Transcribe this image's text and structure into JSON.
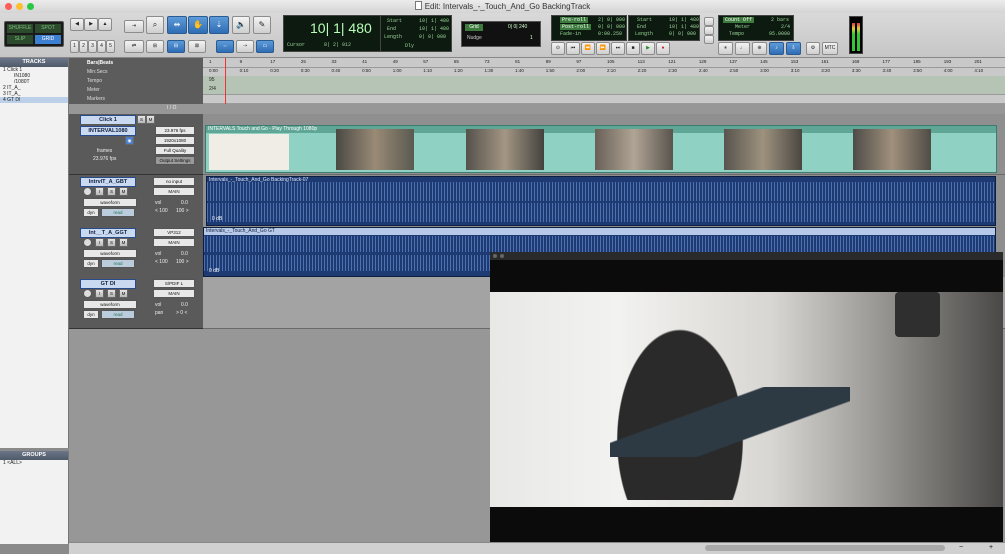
{
  "window": {
    "title": "Edit: Intervals_-_Touch_And_Go BackingTrack"
  },
  "toolbar": {
    "modes": [
      "SHUFFLE",
      "SPOT",
      "SLIP",
      "GRID"
    ],
    "zoom_presets": [
      "1",
      "2",
      "3",
      "4",
      "5"
    ],
    "main_counter": "10| 1| 480",
    "cursor_label": "Cursor",
    "cursor_value": "8| 2| 012",
    "dly_label": "Dly",
    "start_label": "Start",
    "start_value": "10| 1| 480",
    "end_label": "End",
    "end_value": "10| 1| 480",
    "length_label": "Length",
    "length_value": "0| 0| 000",
    "grid_label": "Grid",
    "grid_value": "0| 0| 240",
    "nudge_label": "Nudge",
    "nudge_value": "1",
    "preroll_label": "Pre-roll",
    "preroll_value": "2| 0| 000",
    "postroll_label": "Post-roll",
    "postroll_value": "0| 0| 000",
    "fadein_label": "Fade-in",
    "fadein_value": "0:00.250",
    "t_start_label": "Start",
    "t_start_value": "10| 1| 480",
    "t_end_label": "End",
    "t_end_value": "10| 1| 480",
    "t_length_label": "Length",
    "t_length_value": "0| 0| 000",
    "countoff_label": "Count Off",
    "countoff_value": "2 bars",
    "meter_label": "Meter",
    "meter_value": "2/4",
    "tempo_label": "Tempo",
    "tempo_value": "95.0000",
    "mtc_label": "MTC"
  },
  "tracks_panel": {
    "title": "TRACKS",
    "items": [
      {
        "label": "1  Click 1"
      },
      {
        "label": "IN1080"
      },
      {
        "label": "/1080T"
      },
      {
        "label": "2  IT_A_"
      },
      {
        "label": "3  IT_A_"
      },
      {
        "label": "4  GT DI"
      }
    ]
  },
  "groups_panel": {
    "title": "GROUPS",
    "items": [
      {
        "label": "1  <ALL>"
      }
    ]
  },
  "rulers": {
    "bars_label": "Bars|Beats",
    "mins_label": "Min:Secs",
    "tempo_label": "Tempo",
    "meter_label": "Meter",
    "markers_label": "Markers",
    "tempo_value": "95",
    "meter_value": "2/4",
    "bars": [
      "1",
      "9",
      "17",
      "25",
      "33",
      "41",
      "49",
      "57",
      "65",
      "73",
      "81",
      "89",
      "97",
      "105",
      "113",
      "121",
      "129",
      "137",
      "145",
      "153",
      "161",
      "169",
      "177",
      "185",
      "193",
      "201"
    ],
    "mins": [
      "0:00",
      "0:10",
      "0:20",
      "0:30",
      "0:40",
      "0:50",
      "1:00",
      "1:10",
      "1:20",
      "1:30",
      "1:40",
      "1:50",
      "2:00",
      "2:10",
      "2:20",
      "2:30",
      "2:40",
      "2:50",
      "3:00",
      "3:10",
      "3:20",
      "3:30",
      "3:40",
      "3:50",
      "4:00",
      "4:10"
    ]
  },
  "io_header": {
    "io_label": "I / O"
  },
  "tracks": [
    {
      "name": "Click 1",
      "buttons": [
        "S",
        "M"
      ],
      "io_in": "",
      "io_out": ""
    },
    {
      "name": "INTERVAL1080",
      "fps": "23.976 fps",
      "res": "1920x1080",
      "quality": "Full Quality",
      "output": "Output Settings",
      "frames_label": "frames",
      "frames_fps": "23.976 fps",
      "clip_title": "INTERVALS Touch and Go - Play Through 1080p"
    },
    {
      "name": "IntrvlT_A_GBT",
      "io_in": "no input",
      "io_out": "MAIN",
      "view": "waveform",
      "dyn": "dyn",
      "mode": "read",
      "vol_label": "vol",
      "vol": "0.0",
      "pan_l": "< 100",
      "pan_r": "100 >",
      "clip_title": "Intervals_-_Touch_And_Go BackingTrack-07",
      "db_label": "0 dB"
    },
    {
      "name": "Int__T_A_GGT",
      "io_in": "VP312",
      "io_out": "MAIN",
      "view": "waveform",
      "dyn": "dyn",
      "mode": "read",
      "vol_label": "vol",
      "vol": "0.0",
      "pan_l": "< 100",
      "pan_r": "100 >",
      "clip_title": "Intervals_-_Touch_And_Go GT",
      "db_label": "0 dB"
    },
    {
      "name": "GT DI",
      "io_in": "S/PDIF L",
      "io_out": "MAIN",
      "view": "waveform",
      "dyn": "dyn",
      "mode": "read",
      "vol_label": "vol",
      "vol": "0.0",
      "pan_label": "pan",
      "pan": "> 0 <"
    }
  ],
  "colors": {
    "video_clip": "#8fd1c3",
    "audio_clip": "#1d3a72",
    "track_name_bg": "#c9d9f0",
    "grid_blue": "#2f6db4"
  }
}
